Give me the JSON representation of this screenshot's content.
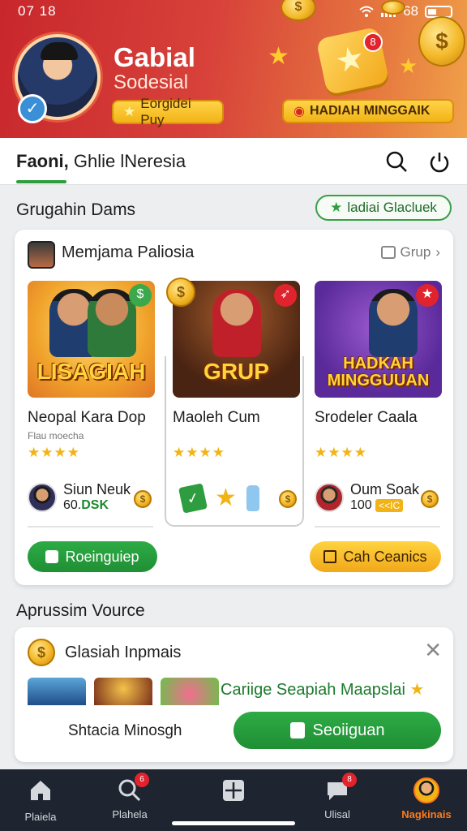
{
  "status": {
    "time": "07 18",
    "battery": "68"
  },
  "profile": {
    "name": "Gabial",
    "subtitle": "Sodesial",
    "badge": "Eorgidei Puy",
    "promo": "HADIAH MINGGAIK",
    "gift_badge": "8"
  },
  "tabbar": {
    "title_bold": "Faoni,",
    "title_rest": " Ghlie lNeresia"
  },
  "section1": {
    "title": "Grugahin Dams",
    "action": "ladiai Glacluek",
    "card_title": "Memjama Paliosia",
    "card_link": "Grup",
    "games": [
      {
        "banner": "LISAGIAH",
        "name": "Neopal Kara Dop",
        "sub": "Flau moecha",
        "stars": "★★★★",
        "owner": "Siun Neuk",
        "owner_value_prefix": "60.",
        "owner_value_bold": "DSK",
        "corner": "$"
      },
      {
        "banner": "GRUP",
        "name": "Maoleh Cum",
        "sub": "",
        "stars": "★★★★",
        "corner": "➶"
      },
      {
        "banner": "HADKAH MINGGUUAN",
        "name": "Srodeler Caala",
        "sub": "",
        "stars": "★★★★",
        "owner": "Oum Soak",
        "owner_value_prefix": "100",
        "owner_value_tag": "<<IC",
        "corner": "★"
      }
    ],
    "btn_left": "Roeinguiep",
    "btn_right": "Cah Ceanics"
  },
  "section2": {
    "title": "Aprussim Vource",
    "card_title": "Glasiah Inpmais",
    "promo": "Cariige Seapiah Maapslai",
    "left_text": "Shtacia Minosgh",
    "button": "Seoiiguan"
  },
  "bottomnav": [
    {
      "label": "Plaiela",
      "icon": "home-icon"
    },
    {
      "label": "Plahela",
      "icon": "search-icon",
      "badge": "6"
    },
    {
      "label": "",
      "icon": "grid-icon"
    },
    {
      "label": "Ulisal",
      "icon": "chat-icon",
      "badge": "8"
    },
    {
      "label": "Nagkinais",
      "icon": "profile-icon"
    }
  ],
  "colors": {
    "accent_green": "#2eab45",
    "accent_gold": "#f2b316",
    "header_red": "#c8272c",
    "active_nav": "#ff7a1a"
  }
}
